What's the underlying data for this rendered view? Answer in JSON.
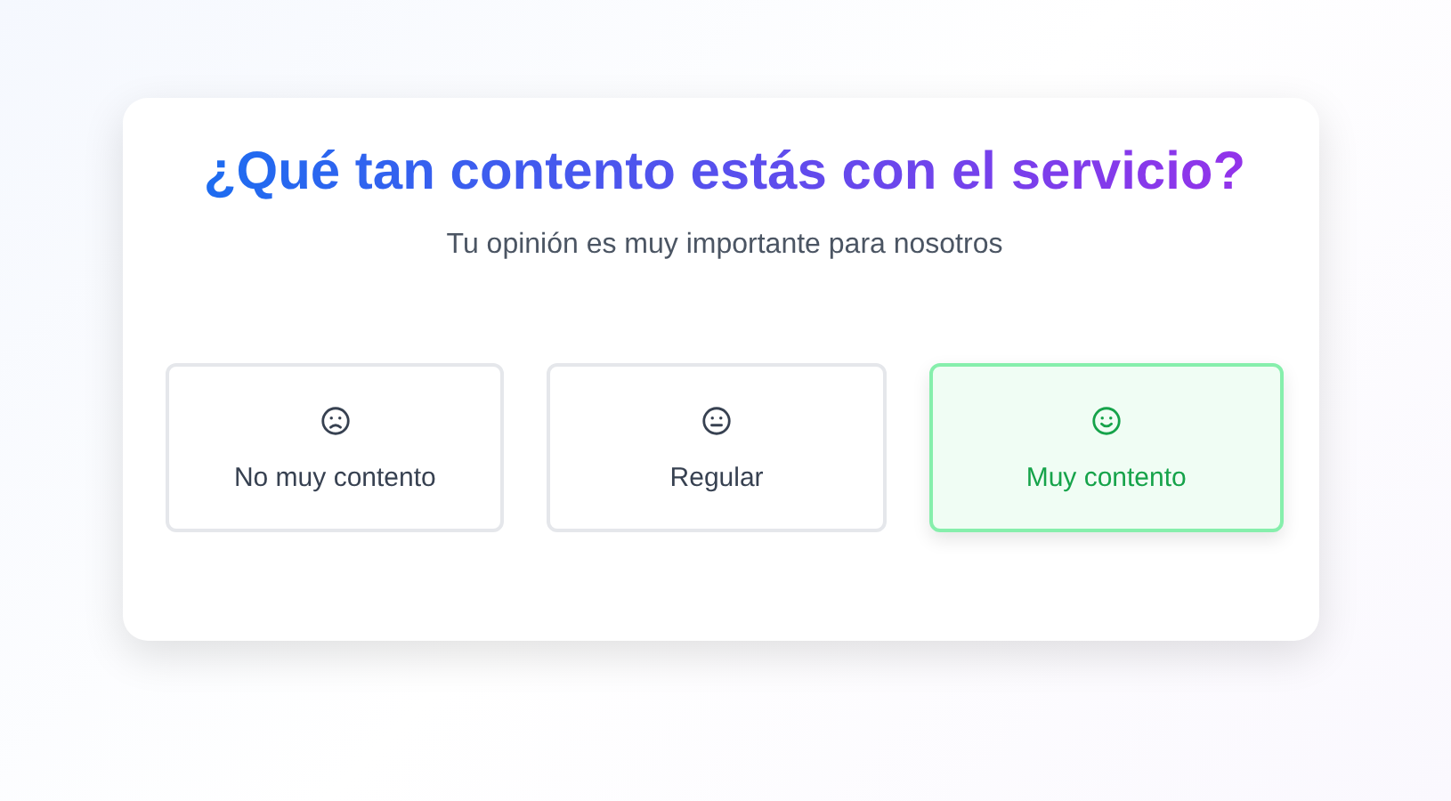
{
  "title": "¿Qué tan contento estás con el servicio?",
  "subtitle": "Tu opinión es muy importante para nosotros",
  "options": [
    {
      "label": "No muy contento",
      "kind": "sad",
      "selected": false
    },
    {
      "label": "Regular",
      "kind": "neutral",
      "selected": false
    },
    {
      "label": "Muy contento",
      "kind": "happy",
      "selected": true
    }
  ]
}
